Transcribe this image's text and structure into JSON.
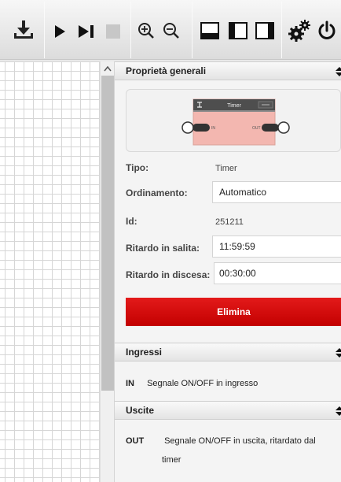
{
  "toolbar": {
    "buttons": [
      {
        "name": "download-icon"
      },
      {
        "name": "play-icon"
      },
      {
        "name": "step-forward-icon"
      },
      {
        "name": "stop-icon"
      },
      {
        "name": "zoom-in-icon"
      },
      {
        "name": "zoom-out-icon"
      },
      {
        "name": "layout-bottom-panel-icon"
      },
      {
        "name": "layout-left-panel-icon"
      },
      {
        "name": "layout-right-panel-icon"
      },
      {
        "name": "settings-gears-icon"
      },
      {
        "name": "power-icon"
      }
    ]
  },
  "general": {
    "title": "Proprietà generali",
    "block": {
      "title": "Timer",
      "in_label": "IN",
      "out_label": "OUT"
    },
    "type_label": "Tipo:",
    "type_value": "Timer",
    "order_label": "Ordinamento:",
    "order_value": "Automatico",
    "id_label": "Id:",
    "id_value": "251211",
    "rise_delay_label": "Ritardo in salita:",
    "rise_delay_value": "11:59:59",
    "fall_delay_label": "Ritardo in discesa:",
    "fall_delay_value": "00:30:00",
    "delete_label": "Elimina"
  },
  "inputs": {
    "title": "Ingressi",
    "items": [
      {
        "name": "IN",
        "desc": "Segnale ON/OFF in ingresso"
      }
    ]
  },
  "outputs": {
    "title": "Uscite",
    "items": [
      {
        "name": "OUT",
        "desc_line1": "Segnale ON/OFF in uscita, ritardato dal",
        "desc_line2": "timer"
      }
    ]
  },
  "colors": {
    "accent_red": "#d40a0a",
    "block_fill": "#f3b7b0",
    "block_header": "#4e4e4e"
  }
}
